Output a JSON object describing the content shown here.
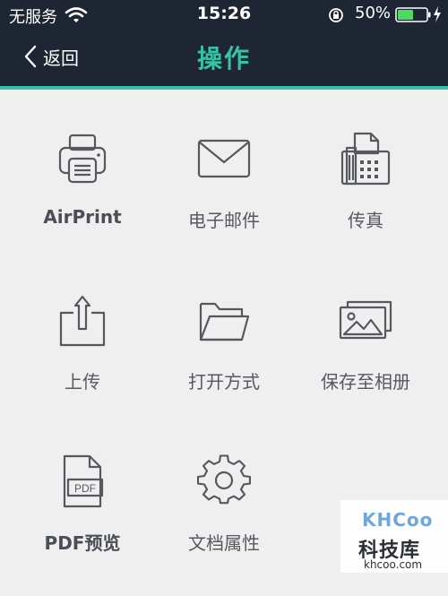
{
  "status_bar": {
    "carrier": "无服务",
    "time": "15:26",
    "battery_percent": "50%"
  },
  "nav": {
    "back_label": "返回",
    "title": "操作"
  },
  "actions": [
    {
      "label": "AirPrint",
      "icon": "printer-icon"
    },
    {
      "label": "电子邮件",
      "icon": "envelope-icon"
    },
    {
      "label": "传真",
      "icon": "fax-icon"
    },
    {
      "label": "上传",
      "icon": "upload-icon"
    },
    {
      "label": "打开方式",
      "icon": "folder-icon"
    },
    {
      "label": "保存至相册",
      "icon": "photo-album-icon"
    },
    {
      "label": "PDF预览",
      "icon": "pdf-file-icon"
    },
    {
      "label": "文档属性",
      "icon": "gear-icon"
    }
  ],
  "icon_text": {
    "pdf": "PDF"
  },
  "watermark": {
    "logo": "KHCoo",
    "name": "科技库",
    "url": "khcoo.com"
  },
  "colors": {
    "header_bg": "#1e2633",
    "accent": "#35c3a7",
    "page_bg": "#efeff0",
    "icon_stroke": "#55595e"
  }
}
